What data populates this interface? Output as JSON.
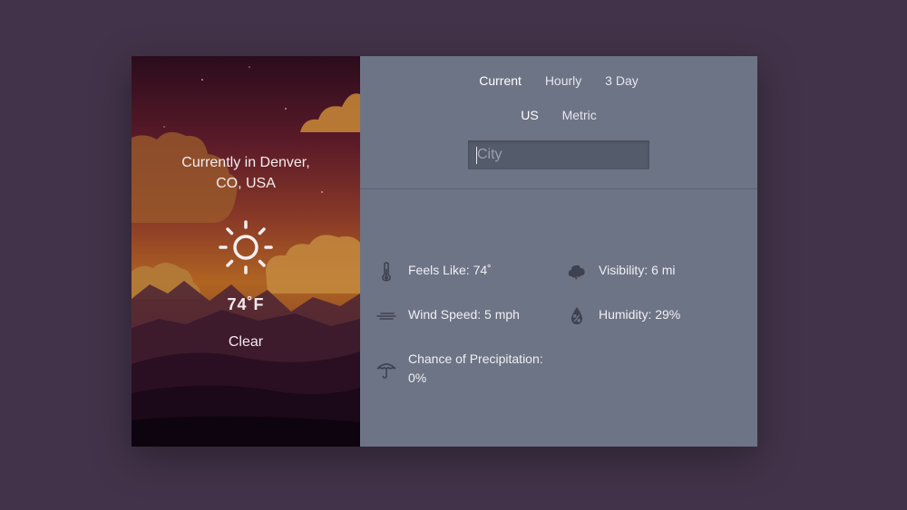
{
  "location": {
    "line1": "Currently in Denver,",
    "line2": "CO, USA"
  },
  "current": {
    "icon": "sun-icon",
    "temperature": "74˚F",
    "condition": "Clear"
  },
  "tabs": [
    {
      "label": "Current",
      "active": true
    },
    {
      "label": "Hourly",
      "active": false
    },
    {
      "label": "3 Day",
      "active": false
    }
  ],
  "units": [
    {
      "label": "US",
      "active": true
    },
    {
      "label": "Metric",
      "active": false
    }
  ],
  "search": {
    "placeholder": "City",
    "value": ""
  },
  "stats": {
    "feels_like": "Feels Like: 74˚",
    "visibility": "Visibility: 6 mi",
    "wind_speed": "Wind Speed: 5 mph",
    "humidity": "Humidity: 29%",
    "precipitation": "Chance of Precipitation: 0%"
  },
  "colors": {
    "page_background": "#43334a",
    "details_panel": "#6d7485",
    "search_field": "#545b6a"
  }
}
